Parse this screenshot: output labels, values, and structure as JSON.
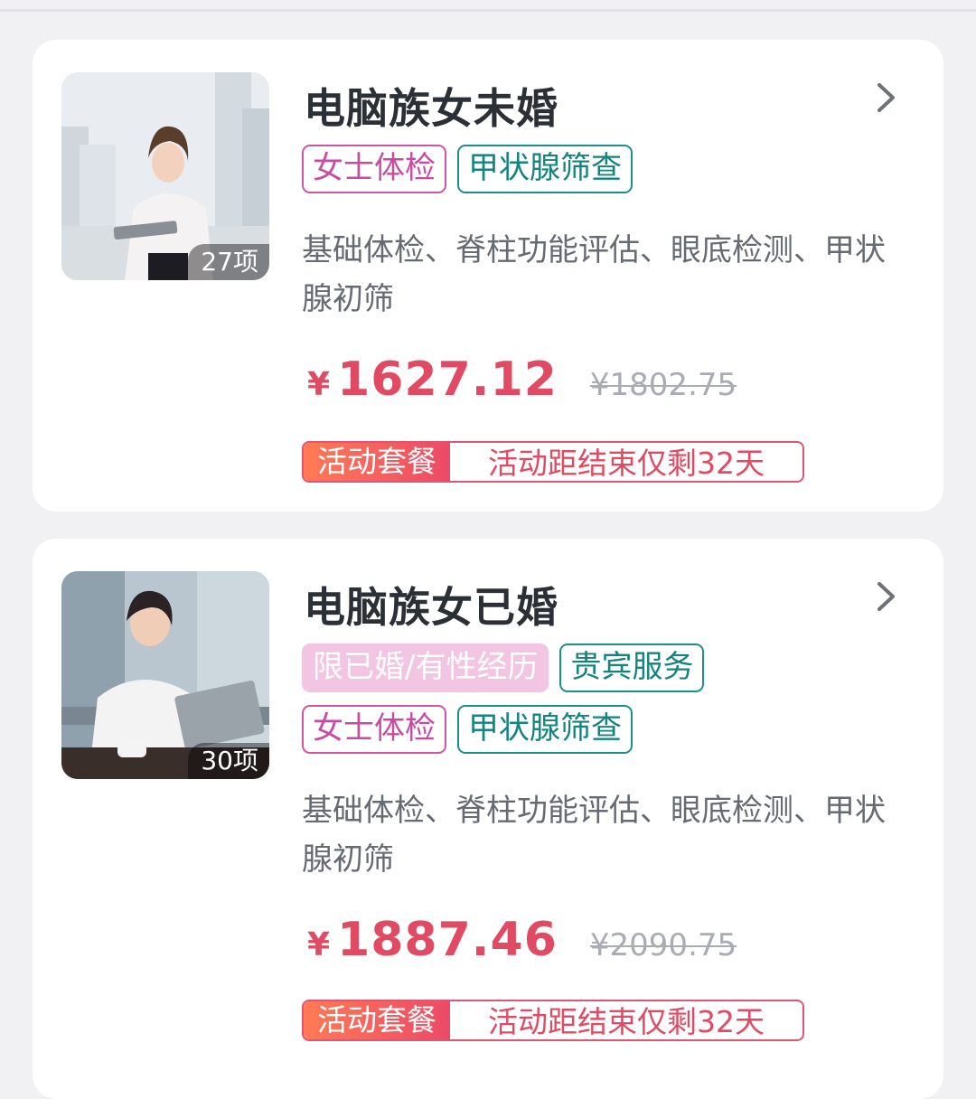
{
  "cards": [
    {
      "title": "电脑族女未婚",
      "item_count": "27项",
      "tag_rows": [
        [
          {
            "label": "女士体检",
            "style": "pink"
          },
          {
            "label": "甲状腺筛查",
            "style": "teal"
          }
        ]
      ],
      "description": "基础体检、脊柱功能评估、眼底检测、甲状腺初筛",
      "price_symbol": "¥",
      "price": "1627.12",
      "original_price": "¥1802.75",
      "promo_label": "活动套餐",
      "promo_text": "活动距结束仅剩32天",
      "image": "woman-holding-tablet-photo"
    },
    {
      "title": "电脑族女已婚",
      "item_count": "30项",
      "tag_rows": [
        [
          {
            "label": "限已婚/有性经历",
            "style": "filled"
          },
          {
            "label": "贵宾服务",
            "style": "teal"
          }
        ],
        [
          {
            "label": "女士体检",
            "style": "pink"
          },
          {
            "label": "甲状腺筛查",
            "style": "teal"
          }
        ]
      ],
      "description": "基础体检、脊柱功能评估、眼底检测、甲状腺初筛",
      "price_symbol": "¥",
      "price": "1887.46",
      "original_price": "¥2090.75",
      "promo_label": "活动套餐",
      "promo_text": "活动距结束仅剩32天",
      "image": "woman-using-laptop-photo"
    }
  ],
  "icons": {
    "arrow": "chevron-right-icon"
  },
  "colors": {
    "price": "#e04a62",
    "tag_pink": "#cf55a6",
    "tag_teal": "#1d8f8a",
    "promo_gradient_start": "#ff7a55"
  }
}
